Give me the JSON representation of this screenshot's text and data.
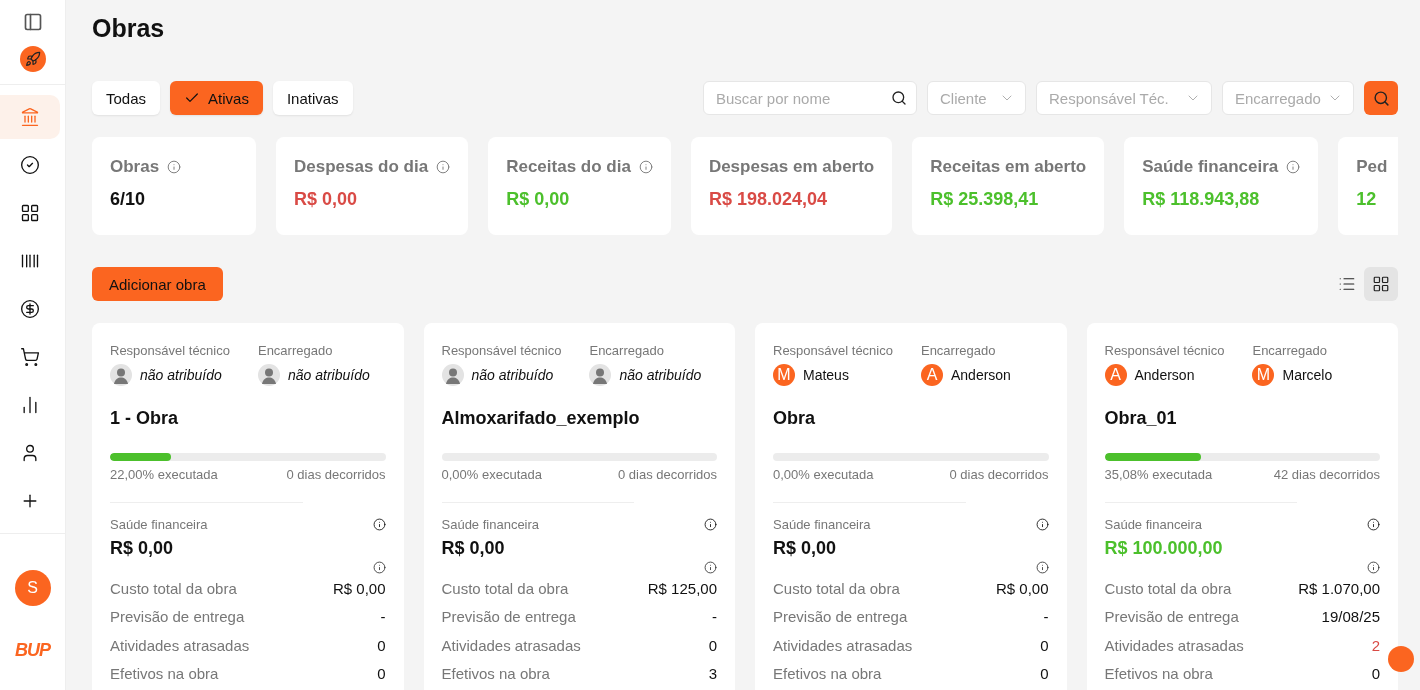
{
  "sidebar": {
    "nav": [
      {
        "kind": "bank",
        "selected": true
      },
      {
        "kind": "check",
        "selected": false
      },
      {
        "kind": "grid",
        "selected": false
      },
      {
        "kind": "barcode",
        "selected": false
      },
      {
        "kind": "dollar",
        "selected": false
      },
      {
        "kind": "cart",
        "selected": false
      },
      {
        "kind": "chart",
        "selected": false
      },
      {
        "kind": "user",
        "selected": false
      },
      {
        "kind": "plus",
        "selected": false
      }
    ],
    "user_initial": "S",
    "logo": "BUP"
  },
  "title": "Obras",
  "filter_tabs": [
    {
      "label": "Todas",
      "selected": false
    },
    {
      "label": "Ativas",
      "selected": true
    },
    {
      "label": "Inativas",
      "selected": false
    }
  ],
  "search": {
    "placeholder": "Buscar por nome"
  },
  "dropdowns": [
    {
      "placeholder": "Cliente"
    },
    {
      "placeholder": "Responsável Téc."
    },
    {
      "placeholder": "Encarregado"
    }
  ],
  "stats": [
    {
      "label": "Obras",
      "info": true,
      "value": "6/10",
      "color": "#111111"
    },
    {
      "label": "Despesas do dia",
      "info": true,
      "value": "R$ 0,00",
      "color": "#d94a45"
    },
    {
      "label": "Receitas do dia",
      "info": true,
      "value": "R$ 0,00",
      "color": "#4cc02c"
    },
    {
      "label": "Despesas em aberto",
      "info": false,
      "value": "R$ 198.024,04",
      "color": "#d94a45"
    },
    {
      "label": "Receitas em aberto",
      "info": false,
      "value": "R$ 25.398,41",
      "color": "#4cc02c"
    },
    {
      "label": "Saúde financeira",
      "info": true,
      "value": "R$ 118.943,88",
      "color": "#4cc02c"
    },
    {
      "label": "Ped",
      "info": false,
      "value": "12",
      "color": "#4cc02c"
    }
  ],
  "add_button": "Adicionar obra",
  "view_toggle": [
    {
      "kind": "list",
      "selected": false
    },
    {
      "kind": "grid",
      "selected": true
    }
  ],
  "projects": [
    {
      "people": [
        {
          "role": "Responsável técnico",
          "name": "não atribuído",
          "assigned": false
        },
        {
          "role": "Encarregado",
          "name": "não atribuído",
          "assigned": false
        }
      ],
      "name": "1 - Obra",
      "level": 0.22,
      "executed": "22,00% executada",
      "days": "0 dias decorridos",
      "health_label": "Saúde financeira",
      "health": {
        "value": "R$ 0,00",
        "color": "#111111"
      },
      "rows": [
        {
          "label": "Custo total da obra",
          "value": "R$ 0,00",
          "color": "#111111"
        },
        {
          "label": "Previsão de entrega",
          "value": "-"
        },
        {
          "label": "Atividades atrasadas",
          "value": "0",
          "color": "#111111"
        },
        {
          "label": "Efetivos na obra",
          "value": "0",
          "color": "#111111"
        }
      ]
    },
    {
      "people": [
        {
          "role": "Responsável técnico",
          "name": "não atribuído",
          "assigned": false
        },
        {
          "role": "Encarregado",
          "name": "não atribuído",
          "assigned": false
        }
      ],
      "name": "Almoxarifado_exemplo",
      "level": 0,
      "executed": "0,00% executada",
      "days": "0 dias decorridos",
      "health_label": "Saúde financeira",
      "health": {
        "value": "R$ 0,00",
        "color": "#111111"
      },
      "rows": [
        {
          "label": "Custo total da obra",
          "value": "R$ 125,00",
          "color": "#111111"
        },
        {
          "label": "Previsão de entrega",
          "value": "-"
        },
        {
          "label": "Atividades atrasadas",
          "value": "0",
          "color": "#111111"
        },
        {
          "label": "Efetivos na obra",
          "value": "3",
          "color": "#111111"
        }
      ]
    },
    {
      "people": [
        {
          "role": "Responsável técnico",
          "name": "Mateus",
          "initial": "M",
          "assigned": true
        },
        {
          "role": "Encarregado",
          "name": "Anderson",
          "initial": "A",
          "assigned": true
        }
      ],
      "name": "Obra",
      "level": 0,
      "executed": "0,00% executada",
      "days": "0 dias decorridos",
      "health_label": "Saúde financeira",
      "health": {
        "value": "R$ 0,00",
        "color": "#111111"
      },
      "rows": [
        {
          "label": "Custo total da obra",
          "value": "R$ 0,00",
          "color": "#111111"
        },
        {
          "label": "Previsão de entrega",
          "value": "-"
        },
        {
          "label": "Atividades atrasadas",
          "value": "0",
          "color": "#111111"
        },
        {
          "label": "Efetivos na obra",
          "value": "0",
          "color": "#111111"
        }
      ]
    },
    {
      "people": [
        {
          "role": "Responsável técnico",
          "name": "Anderson",
          "initial": "A",
          "assigned": true
        },
        {
          "role": "Encarregado",
          "name": "Marcelo",
          "initial": "M",
          "assigned": true
        }
      ],
      "name": "Obra_01",
      "level": 0.35,
      "executed": "35,08% executada",
      "days": "42 dias decorridos",
      "health_label": "Saúde financeira",
      "health": {
        "value": "R$ 100.000,00",
        "color": "#4cc02c"
      },
      "rows": [
        {
          "label": "Custo total da obra",
          "value": "R$ 1.070,00",
          "color": "#111111"
        },
        {
          "label": "Previsão de entrega",
          "value": "19/08/25",
          "color": "#111111"
        },
        {
          "label": "Atividades atrasadas",
          "value": "2",
          "color": "#d94a45"
        },
        {
          "label": "Efetivos na obra",
          "value": "0",
          "color": "#111111"
        }
      ]
    }
  ]
}
